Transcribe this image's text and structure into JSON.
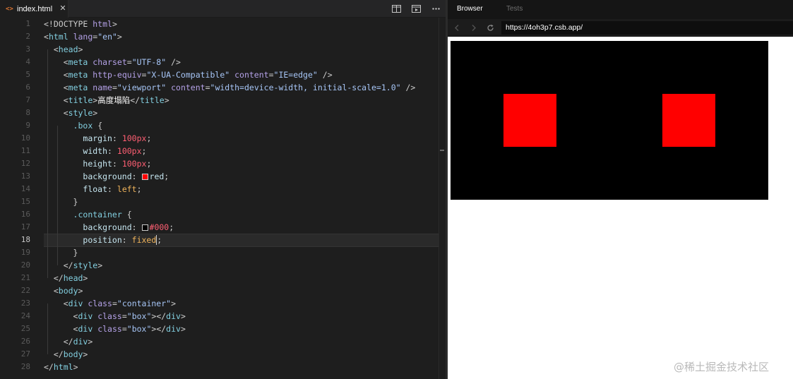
{
  "editor": {
    "tab": {
      "icon": "<>",
      "label": "index.html",
      "close": "✕"
    },
    "line_numbers": [
      "1",
      "2",
      "3",
      "4",
      "5",
      "6",
      "7",
      "8",
      "9",
      "10",
      "11",
      "12",
      "13",
      "14",
      "15",
      "16",
      "17",
      "18",
      "19",
      "20",
      "21",
      "22",
      "23",
      "24",
      "25",
      "26",
      "27",
      "28"
    ],
    "current_line": 18,
    "actions": [
      "split-editor-icon",
      "preview-icon",
      "more-icon"
    ]
  },
  "browser": {
    "tabs": {
      "browser": "Browser",
      "tests": "Tests"
    },
    "url": "https://4oh3p7.csb.app/",
    "container_color": "#000000",
    "box_color": "#ff0000"
  },
  "watermark": "@稀土掘金技术社区"
}
